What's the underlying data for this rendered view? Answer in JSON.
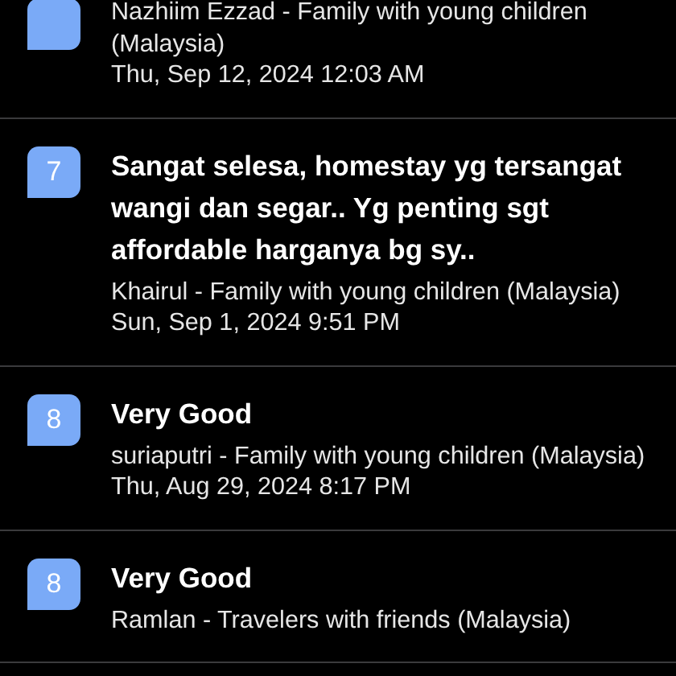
{
  "reviews": [
    {
      "author": "Nazhiim Ezzad - Family with young children (Malaysia)",
      "date": "Thu, Sep 12, 2024 12:03 AM"
    },
    {
      "score": "7",
      "title": "Sangat selesa, homestay yg tersangat wangi dan segar.. Yg penting sgt affordable harganya bg sy..",
      "author": "Khairul - Family with young children (Malaysia)",
      "date": "Sun, Sep 1, 2024 9:51 PM"
    },
    {
      "score": "8",
      "title": "Very Good",
      "author": "suriaputri - Family with young children (Malaysia)",
      "date": "Thu, Aug 29, 2024 8:17 PM"
    },
    {
      "score": "8",
      "title": "Very Good",
      "author": "Ramlan - Travelers with friends (Malaysia)"
    }
  ]
}
